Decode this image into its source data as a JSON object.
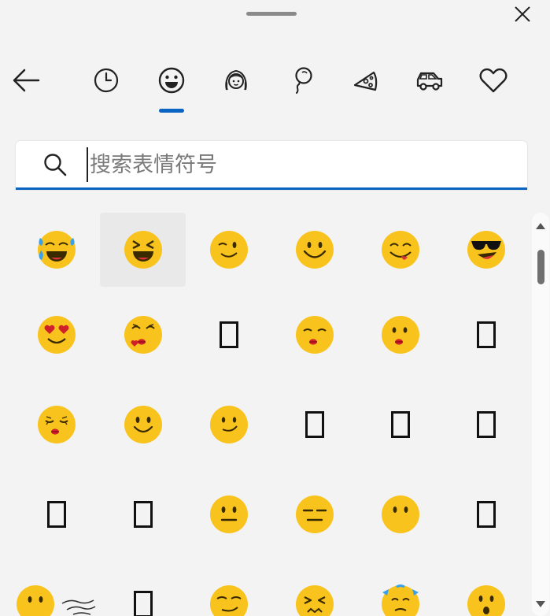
{
  "window": {
    "close_icon": "close-icon"
  },
  "tabs": [
    {
      "name": "back-arrow-icon"
    },
    {
      "name": "recent-clock-icon"
    },
    {
      "name": "smiley-icon",
      "selected": true
    },
    {
      "name": "people-icon"
    },
    {
      "name": "balloon-icon"
    },
    {
      "name": "pizza-icon"
    },
    {
      "name": "car-icon"
    },
    {
      "name": "heart-icon"
    }
  ],
  "search": {
    "placeholder": "搜索表情符号",
    "value": ""
  },
  "colors": {
    "accent": "#0a64c2",
    "emoji_yellow": "#f9c31e",
    "tear_blue": "#3aa0e8",
    "heart_red": "#d0202a"
  },
  "emoji_grid": [
    [
      "face-with-tears-of-joy",
      "grinning-squinting-face",
      "winking-face",
      "smiling-face",
      "face-savoring-food",
      "smiling-face-with-sunglasses"
    ],
    [
      "smiling-face-with-heart-eyes",
      "face-blowing-kiss",
      "unsupported-glyph",
      "kissing-face-with-closed-eyes",
      "kissing-face",
      "unsupported-glyph"
    ],
    [
      "kissing-face-with-smiling-eyes",
      "slightly-smiling-face",
      "smiling-face-relaxed",
      "unsupported-glyph",
      "unsupported-glyph",
      "unsupported-glyph"
    ],
    [
      "unsupported-glyph",
      "unsupported-glyph",
      "neutral-face",
      "expressionless-face",
      "face-without-mouth",
      "unsupported-glyph"
    ],
    [
      "face-without-mouth-partial",
      "face-exhaling-wind",
      "unsupported-glyph",
      "smirking-face",
      "persevering-face",
      "face-with-sweat-drops",
      "hushed-face"
    ]
  ]
}
